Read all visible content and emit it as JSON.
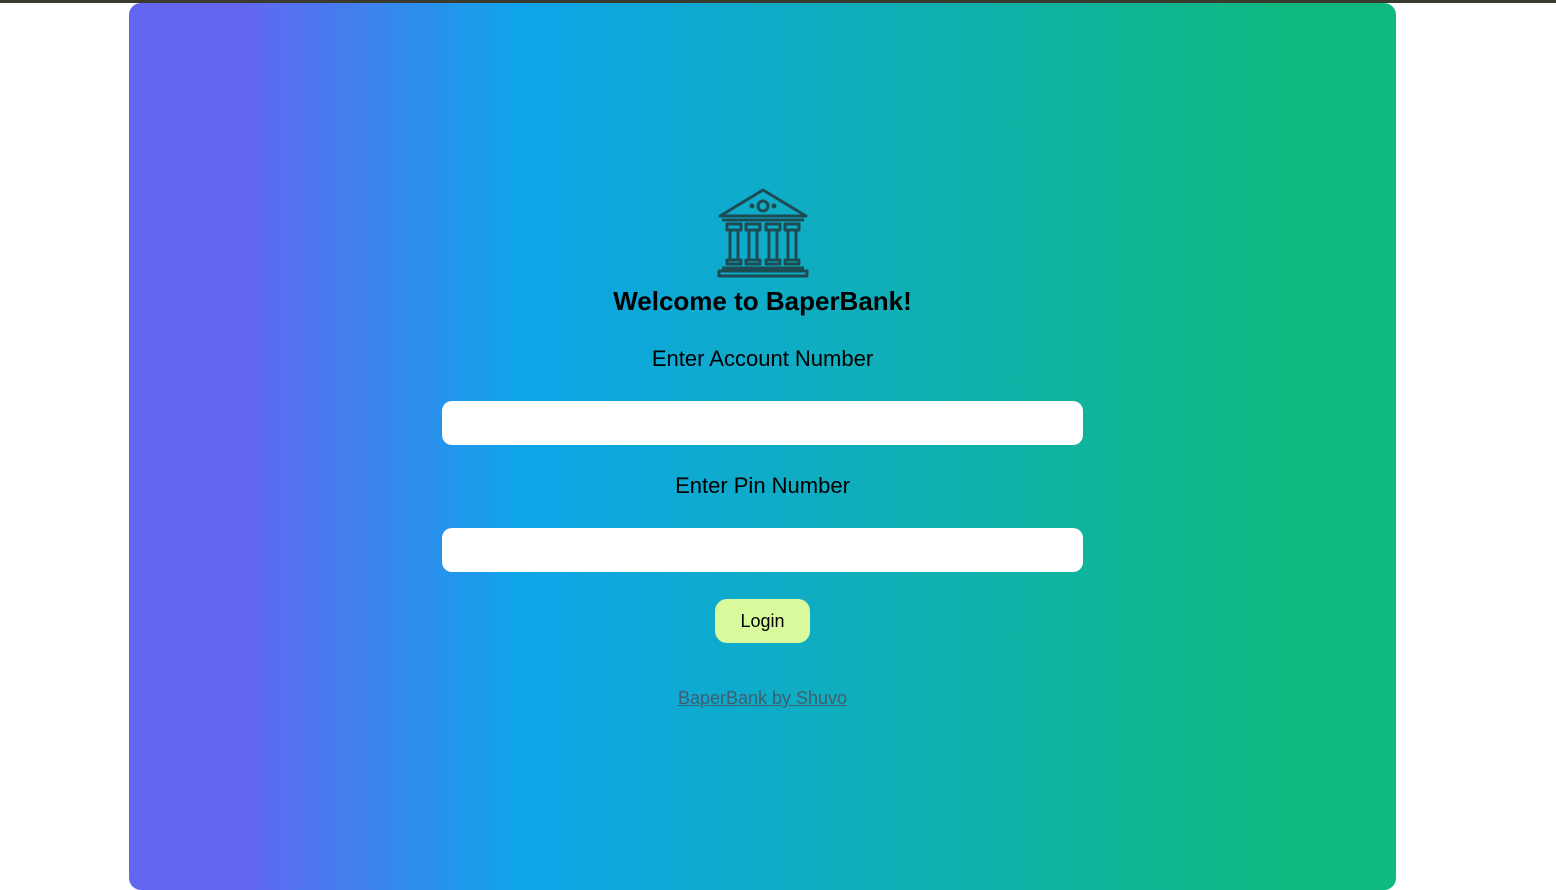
{
  "header": {
    "title": "Welcome to BaperBank!",
    "logo_icon": "bank-building-icon"
  },
  "form": {
    "account_label": "Enter Account Number",
    "account_value": "",
    "pin_label": "Enter Pin Number",
    "pin_value": "",
    "login_label": "Login"
  },
  "footer": {
    "credit_text": "BaperBank by Shuvo"
  },
  "colors": {
    "gradient_start": "#6366f1",
    "gradient_mid": "#0ea5e9",
    "gradient_end": "#10b981",
    "login_button": "#d9f99d",
    "icon_stroke": "#1e4a52"
  }
}
